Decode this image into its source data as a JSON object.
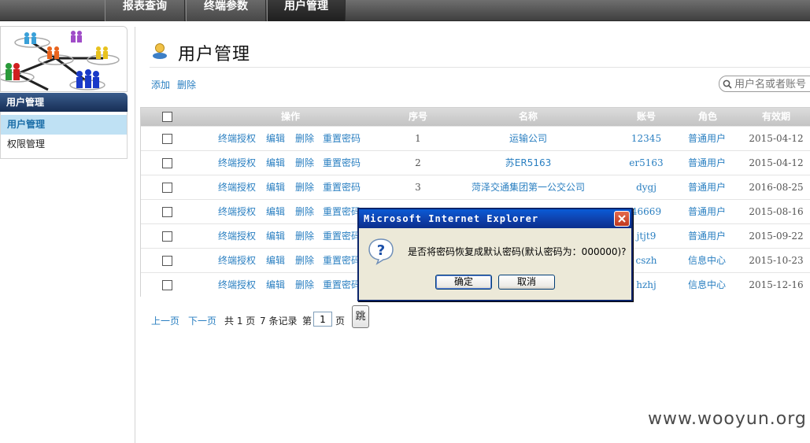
{
  "nav": {
    "tabs": [
      {
        "label": "报表查询"
      },
      {
        "label": "终端参数"
      },
      {
        "label": "用户管理"
      }
    ]
  },
  "sidebar": {
    "header": "用户管理",
    "items": [
      {
        "label": "用户管理"
      },
      {
        "label": "权限管理"
      }
    ]
  },
  "main": {
    "title": "用户管理",
    "add_label": "添加",
    "delete_label": "删除",
    "search_placeholder": "用户名或者账号"
  },
  "table": {
    "headers": {
      "ops": "操作",
      "seq": "序号",
      "name": "名称",
      "account": "账号",
      "role": "角色",
      "expiry": "有效期"
    },
    "action_labels": {
      "authorize": "终端授权",
      "edit": "编辑",
      "delete": "删除",
      "reset": "重置密码"
    },
    "rows": [
      {
        "seq": "1",
        "name": "运输公司",
        "account": "12345",
        "role": "普通用户",
        "expiry": "2015-04-12"
      },
      {
        "seq": "2",
        "name": "苏ER5163",
        "account": "er5163",
        "role": "普通用户",
        "expiry": "2015-04-12"
      },
      {
        "seq": "3",
        "name": "菏泽交通集团第一公交公司",
        "account": "dygj",
        "role": "普通用户",
        "expiry": "2016-08-25"
      },
      {
        "seq": "",
        "name": "",
        "account": "46669",
        "role": "普通用户",
        "expiry": "2015-08-16"
      },
      {
        "seq": "",
        "name": "",
        "account": "jtjt9",
        "role": "普通用户",
        "expiry": "2015-09-22"
      },
      {
        "seq": "",
        "name": "",
        "account": "cszh",
        "role": "信息中心",
        "expiry": "2015-10-23"
      },
      {
        "seq": "",
        "name": "",
        "account": "hzhj",
        "role": "信息中心",
        "expiry": "2015-12-16"
      }
    ]
  },
  "pager": {
    "prev": "上一页",
    "next": "下一页",
    "total_pages": "共 1 页",
    "total_records": "7 条记录",
    "page_prefix": "第",
    "page_value": "1",
    "page_suffix": "页",
    "jump": "跳"
  },
  "dialog": {
    "title": "Microsoft Internet Explorer",
    "message": "是否将密码恢复成默认密码(默认密码为：000000)?",
    "ok_label": "确定",
    "cancel_label": "取消"
  },
  "watermark": "www.wooyun.org",
  "icons": [
    "user-icon",
    "search-icon",
    "question-icon",
    "close-icon"
  ],
  "colors": {
    "link": "#2a7fc1",
    "nav_dark": "#3f3f3f",
    "dialog_title": "#0f3ea8",
    "sidebar_active": "#bfe1f4"
  }
}
